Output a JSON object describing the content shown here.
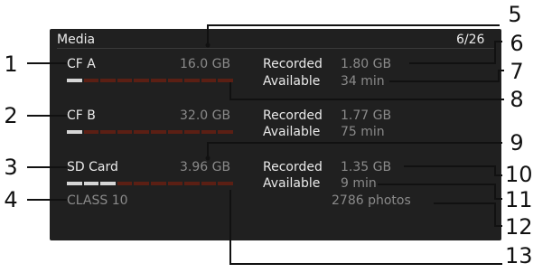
{
  "screen": {
    "title": "Media",
    "page": "6/26"
  },
  "media": [
    {
      "name": "CF A",
      "capacity": "16.0 GB",
      "recorded_label": "Recorded",
      "recorded": "1.80 GB",
      "available_label": "Available",
      "available": "34 min",
      "usage_fraction": 0.1
    },
    {
      "name": "CF B",
      "capacity": "32.0 GB",
      "recorded_label": "Recorded",
      "recorded": "1.77 GB",
      "available_label": "Available",
      "available": "75 min",
      "usage_fraction": 0.1
    },
    {
      "name": "SD Card",
      "capacity": "3.96 GB",
      "recorded_label": "Recorded",
      "recorded": "1.35 GB",
      "available_label": "Available",
      "available": "9 min",
      "photos": "2786 photos",
      "class": "CLASS 10",
      "usage_fraction": 0.3
    }
  ],
  "callouts": [
    "1",
    "2",
    "3",
    "4",
    "5",
    "6",
    "7",
    "8",
    "9",
    "10",
    "11",
    "12",
    "13"
  ],
  "colors": {
    "bar_used": "#d6d6d6",
    "bar_empty": "#5b1f14",
    "screen_bg": "#202020"
  }
}
